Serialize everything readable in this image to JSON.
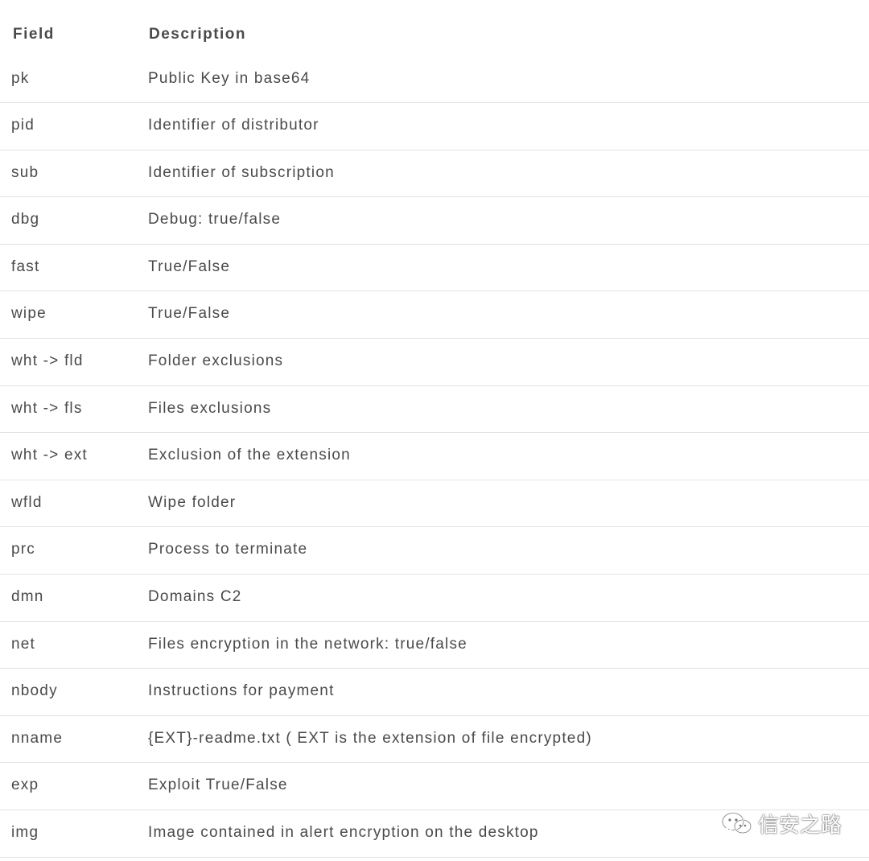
{
  "table": {
    "headers": {
      "field": "Field",
      "description": "Description"
    },
    "rows": [
      {
        "field": "pk",
        "description": "Public Key in base64"
      },
      {
        "field": "pid",
        "description": "Identifier of distributor"
      },
      {
        "field": "sub",
        "description": "Identifier of subscription"
      },
      {
        "field": "dbg",
        "description": "Debug: true/false"
      },
      {
        "field": "fast",
        "description": "True/False"
      },
      {
        "field": "wipe",
        "description": "True/False"
      },
      {
        "field": "wht -> fld",
        "description": "Folder exclusions"
      },
      {
        "field": "wht -> fls",
        "description": "Files exclusions"
      },
      {
        "field": "wht -> ext",
        "description": "Exclusion of the extension"
      },
      {
        "field": "wfld",
        "description": "Wipe folder"
      },
      {
        "field": "prc",
        "description": "Process to terminate"
      },
      {
        "field": "dmn",
        "description": "Domains C2"
      },
      {
        "field": "net",
        "description": "Files encryption in the network: true/false"
      },
      {
        "field": "nbody",
        "description": "Instructions for payment"
      },
      {
        "field": "nname",
        "description": "{EXT}-readme.txt ( EXT is the extension of file encrypted)"
      },
      {
        "field": "exp",
        "description": "Exploit True/False"
      },
      {
        "field": "img",
        "description": "Image contained in alert encryption on the desktop"
      }
    ]
  },
  "watermark": {
    "text": "信安之路",
    "icon": "wechat-icon"
  }
}
